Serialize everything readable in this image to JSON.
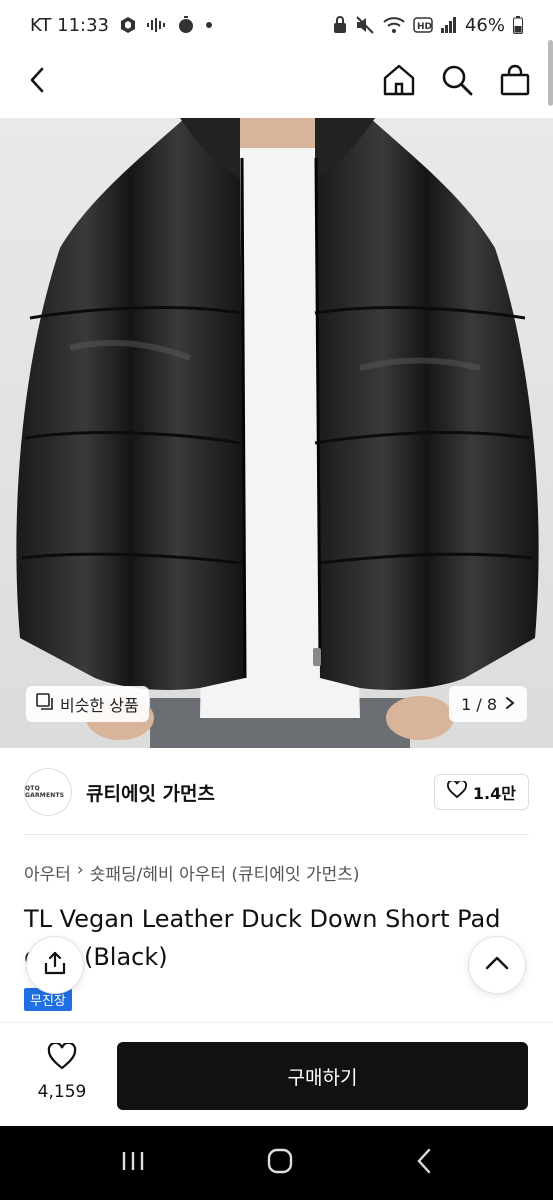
{
  "status_bar": {
    "carrier_time": "KT 11:33",
    "battery": "46%",
    "left_icons": [
      "nfc-icon",
      "signal-dots-icon",
      "alarm-icon",
      "dot-icon"
    ],
    "right_icons": [
      "lock-icon",
      "mute-icon",
      "wifi-icon",
      "hd-icon",
      "cell-signal-icon",
      "battery-icon"
    ]
  },
  "header": {
    "back_icon": "chevron-left-icon",
    "home_icon": "home-icon",
    "search_icon": "search-icon",
    "cart_icon": "shopping-bag-icon"
  },
  "gallery": {
    "similar_label": "비슷한 상품",
    "page_indicator": "1 / 8",
    "next_icon": "chevron-right-icon"
  },
  "brand": {
    "logo_text": "QTQ GARMENTS",
    "name": "큐티에잇 가먼츠",
    "likes": "1.4만"
  },
  "product": {
    "breadcrumb": [
      "아우터",
      "숏패딩/헤비 아우터 (큐티에잇 가먼츠)"
    ],
    "title": "TL Vegan Leather Duck Down Short Pad ding (Black)",
    "badge": "무진장"
  },
  "bottom": {
    "wish_count": "4,159",
    "buy_label": "구매하기"
  },
  "colors": {
    "primary": "#111111",
    "badge_blue": "#1f6fe5",
    "nav_bar": "#000000"
  }
}
